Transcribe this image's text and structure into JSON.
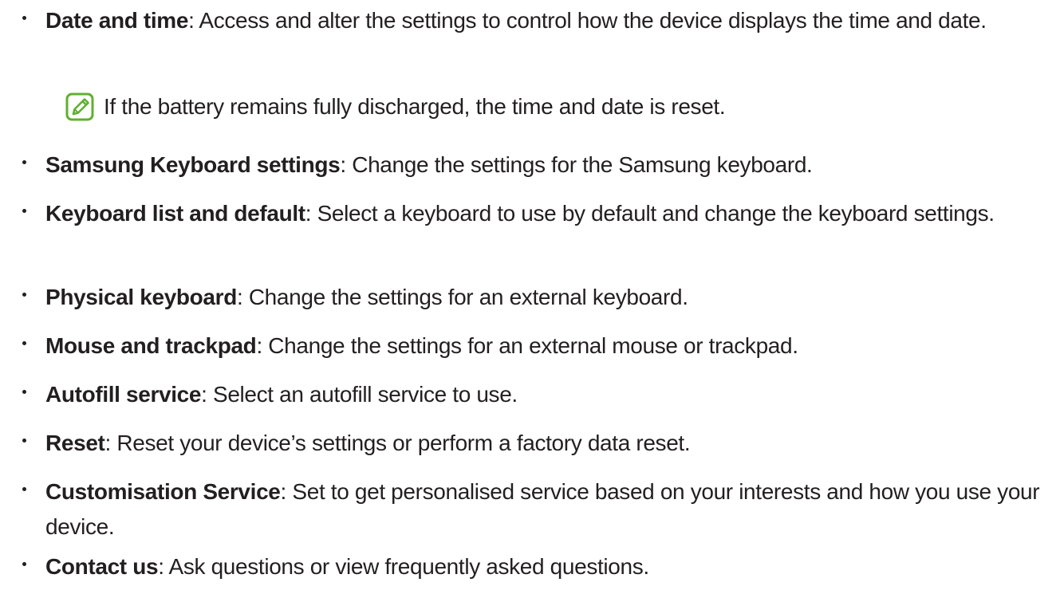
{
  "items": [
    {
      "term": "Date and time",
      "sep": ": ",
      "desc": "Access and alter the settings to control how the device displays the time and date."
    },
    {
      "term": "Samsung Keyboard settings",
      "sep": ": ",
      "desc": "Change the settings for the Samsung keyboard."
    },
    {
      "term": "Keyboard list and default",
      "sep": ": ",
      "desc": "Select a keyboard to use by default and change the keyboard settings."
    },
    {
      "term": "Physical keyboard",
      "sep": ": ",
      "desc": "Change the settings for an external keyboard."
    },
    {
      "term": "Mouse and trackpad",
      "sep": ": ",
      "desc": "Change the settings for an external mouse or trackpad."
    },
    {
      "term": "Autofill service",
      "sep": ": ",
      "desc": "Select an autofill service to use."
    },
    {
      "term": "Reset",
      "sep": ": ",
      "desc": "Reset your device’s settings or perform a factory data reset."
    },
    {
      "term": "Customisation Service",
      "sep": ": ",
      "desc": "Set to get personalised service based on your interests and how you use your device."
    },
    {
      "term": "Contact us",
      "sep": ": ",
      "desc": "Ask questions or view frequently asked questions."
    }
  ],
  "note": {
    "icon": "note-pencil-icon",
    "icon_color": "#5fb030",
    "text": "If the battery remains fully discharged, the time and date is reset."
  }
}
